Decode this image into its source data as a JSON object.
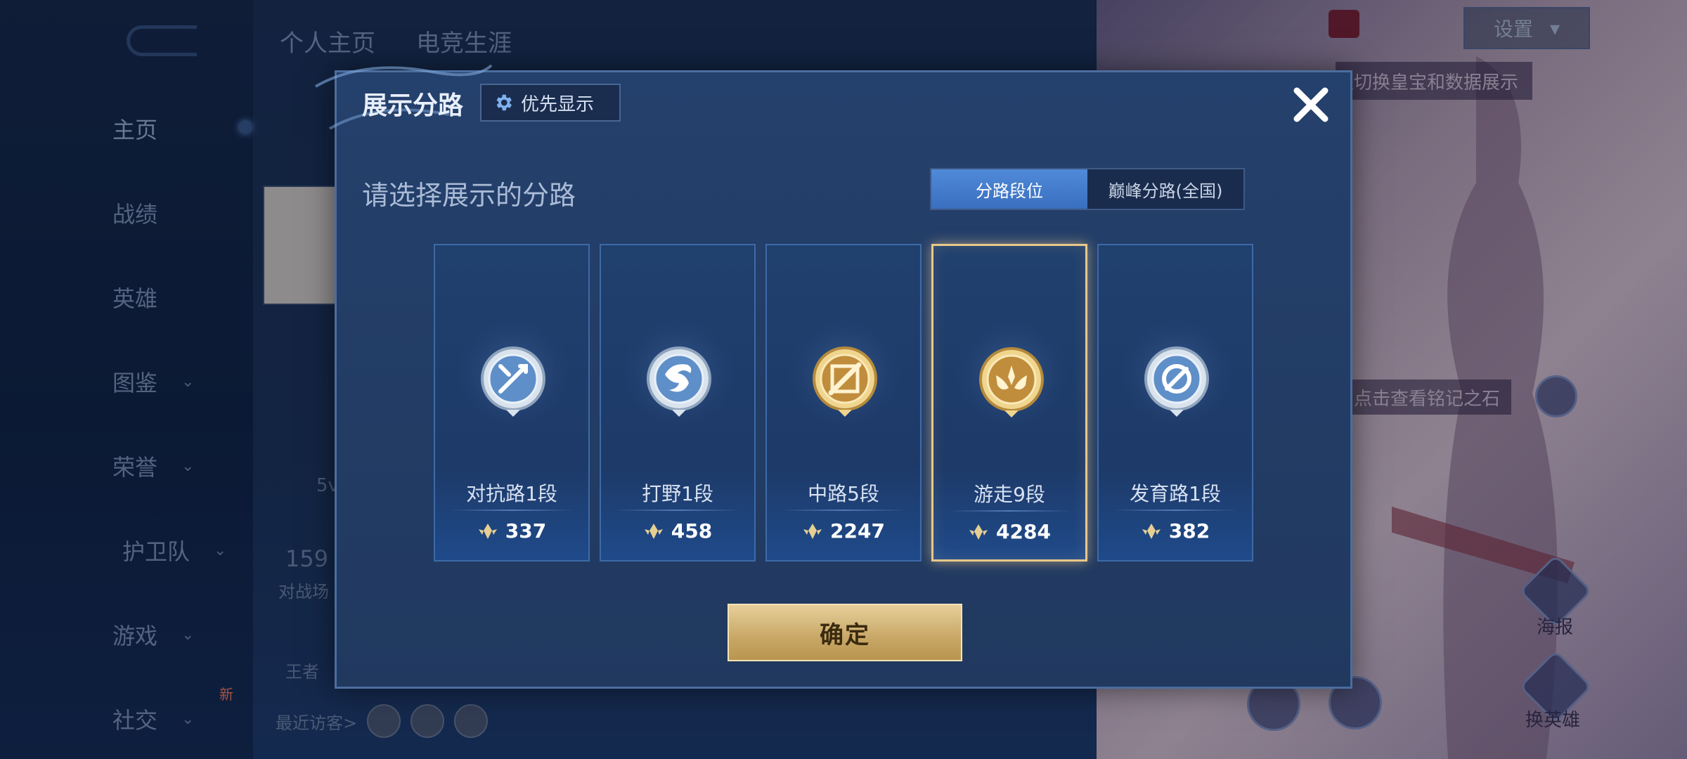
{
  "background": {
    "top_tabs": [
      "个人主页",
      "电竞生涯"
    ],
    "nav": [
      {
        "label": "主页",
        "expandable": false
      },
      {
        "label": "战绩",
        "expandable": false
      },
      {
        "label": "英雄",
        "expandable": false
      },
      {
        "label": "图鉴",
        "expandable": true
      },
      {
        "label": "荣誉",
        "expandable": true
      },
      {
        "label": "护卫队",
        "expandable": true
      },
      {
        "label": "游戏",
        "expandable": true
      },
      {
        "label": "社交",
        "expandable": true
      }
    ],
    "new_badge": "新",
    "stat_value": "159",
    "stat_label": "对战场",
    "rank_label": "王者",
    "recent_visitors": "最近访客>",
    "setting_label": "设置",
    "hint_top": "以切换皇宝和数据展示",
    "hint_mid": "点击查看铭记之石",
    "right_btn_1": "海报",
    "right_btn_2": "换英雄",
    "side_text": "5v"
  },
  "modal": {
    "title": "展示分路",
    "priority_button": "优先显示",
    "subtitle": "请选择展示的分路",
    "segment": {
      "options": [
        "分路段位",
        "巅峰分路(全国)"
      ],
      "active_index": 0
    },
    "cards": [
      {
        "lane": "对抗路1段",
        "score": "337",
        "emblem": "silver-sword",
        "selected": false
      },
      {
        "lane": "打野1段",
        "score": "458",
        "emblem": "silver-swirl",
        "selected": false
      },
      {
        "lane": "中路5段",
        "score": "2247",
        "emblem": "gold-slash",
        "selected": false
      },
      {
        "lane": "游走9段",
        "score": "4284",
        "emblem": "gold-wings",
        "selected": true
      },
      {
        "lane": "发育路1段",
        "score": "382",
        "emblem": "silver-arrow",
        "selected": false
      }
    ],
    "confirm_button": "确定"
  },
  "colors": {
    "modal_bg": "#22406a",
    "accent_blue": "#4f8ad8",
    "gold": "#e8c88a",
    "silver": "#c8d6e6"
  }
}
